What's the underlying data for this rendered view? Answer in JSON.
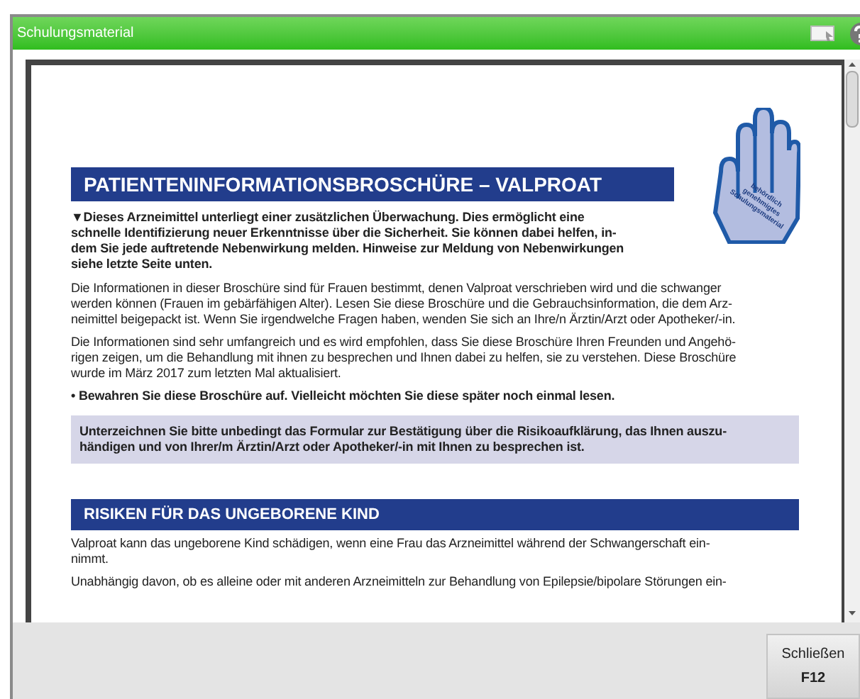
{
  "window": {
    "title": "Schulungsmaterial"
  },
  "document": {
    "title": "PATIENTENINFORMATIONSBROSCHÜRE – VALPROAT",
    "badge_text": [
      "behördlich",
      "genehmigtes",
      "Schulungsmaterial"
    ],
    "blocks": [
      {
        "kind": "bold",
        "lines": [
          "▼Dieses Arzneimittel unterliegt einer zusätzlichen Überwachung. Dies ermöglicht eine",
          "schnelle Identifizierung neuer Erkenntnisse über die Sicherheit. Sie können dabei helfen, in-",
          "dem Sie jede auftretende Nebenwirkung melden. Hinweise zur Meldung von Nebenwirkungen",
          "siehe letzte Seite unten."
        ]
      },
      {
        "kind": "text",
        "lines": [
          "Die Informationen in dieser Broschüre sind für Frauen bestimmt, denen Valproat verschrieben wird und die schwanger",
          "werden können (Frauen im gebärfähigen Alter). Lesen Sie diese Broschüre und die Gebrauchsinformation, die dem Arz-",
          "neimittel beigepackt ist. Wenn Sie irgendwelche Fragen haben, wenden Sie sich an Ihre/n Ärztin/Arzt oder Apotheker/-in."
        ]
      },
      {
        "kind": "text",
        "lines": [
          "Die Informationen sind sehr umfangreich und es wird empfohlen, dass Sie diese Broschüre Ihren Freunden und Angehö-",
          "rigen zeigen, um die Behandlung mit ihnen zu besprechen und Ihnen dabei zu helfen, sie zu verstehen. Diese Broschüre",
          "wurde im März 2017 zum letzten Mal aktualisiert."
        ]
      },
      {
        "kind": "bold",
        "lines": [
          "• Bewahren Sie diese Broschüre auf. Vielleicht möchten Sie diese später noch einmal lesen."
        ]
      },
      {
        "kind": "notice",
        "lines": [
          "Unterzeichnen Sie bitte unbedingt das Formular zur Bestätigung über die Risikoaufklärung, das Ihnen auszu-",
          "händigen und von Ihrer/m Ärztin/Arzt oder Apotheker/-in mit Ihnen zu besprechen ist."
        ]
      },
      {
        "kind": "heading",
        "lines": [
          "RISIKEN FÜR DAS UNGEBORENE KIND"
        ]
      },
      {
        "kind": "text",
        "lines": [
          "Valproat kann das ungeborene Kind schädigen, wenn eine Frau das Arzneimittel während der Schwangerschaft ein-",
          "nimmt."
        ]
      },
      {
        "kind": "text",
        "lines": [
          "Unabhängig davon, ob es alleine oder mit anderen Arzneimitteln zur Behandlung von Epilepsie/bipolare Störungen ein-"
        ]
      }
    ]
  },
  "buttons": [
    {
      "label": "Schließen",
      "key": "F12"
    }
  ]
}
